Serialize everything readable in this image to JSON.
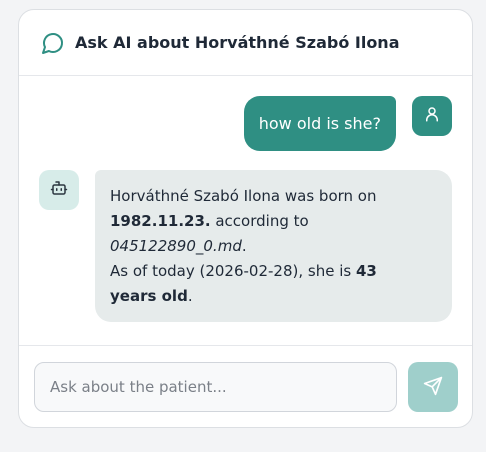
{
  "header": {
    "title": "Ask AI about Horváthné Szabó Ilona",
    "icon": "chat-bubble-icon"
  },
  "messages": [
    {
      "role": "user",
      "text": "how old is she?",
      "avatar_icon": "user-icon"
    },
    {
      "role": "assistant",
      "avatar_icon": "robot-icon",
      "parts": {
        "intro": "Horváthné Szabó Ilona was born on",
        "birth_date": "1982.11.23.",
        "according": " according to",
        "source_file": "045122890_0.md",
        "source_end": ".",
        "today_prefix": "As of today (2026-02-28), she is ",
        "age_part1": "43",
        "age_part2": "years old",
        "age_end": "."
      }
    }
  ],
  "input": {
    "placeholder": "Ask about the patient...",
    "value": ""
  },
  "send_button": {
    "icon": "send-icon"
  },
  "colors": {
    "accent": "#2f8f83",
    "accent_light": "#9fcfcb",
    "bot_bubble": "#e6ebeb",
    "bot_avatar_bg": "#d7ece9"
  }
}
